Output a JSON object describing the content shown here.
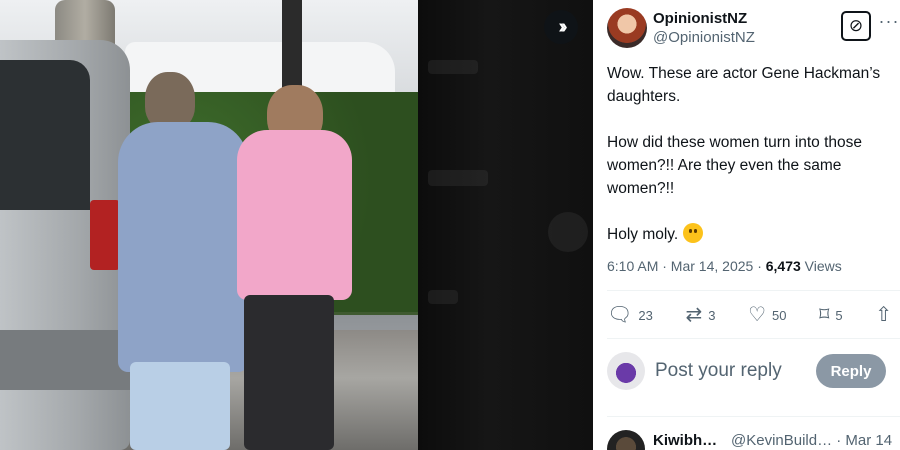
{
  "media": {
    "expand_icon": "double-chevron-right-icon"
  },
  "tweet": {
    "author": {
      "display_name": "OpinionistNZ",
      "handle": "@OpinionistNZ"
    },
    "grok_icon": "grok-icon",
    "more_icon": "more-horizontal-icon",
    "paragraphs": [
      "Wow. These are actor Gene Hackman’s daughters.",
      "How did these women turn into those women?!! Are they even the same women?!!"
    ],
    "last_line": "Holy moly.",
    "emoji": "slightly-frowning-face",
    "timestamp": "6:10 AM · Mar 14, 2025 · ",
    "views_count": "6,473",
    "views_label": " Views",
    "actions": {
      "replies": "23",
      "reposts": "3",
      "likes": "50",
      "bookmarks": "5"
    },
    "reply_box": {
      "placeholder": "Post your reply",
      "button": "Reply"
    },
    "next_reply": {
      "name": "Kiwibh…",
      "handle": "@KevinBuild… · Mar 14"
    }
  }
}
